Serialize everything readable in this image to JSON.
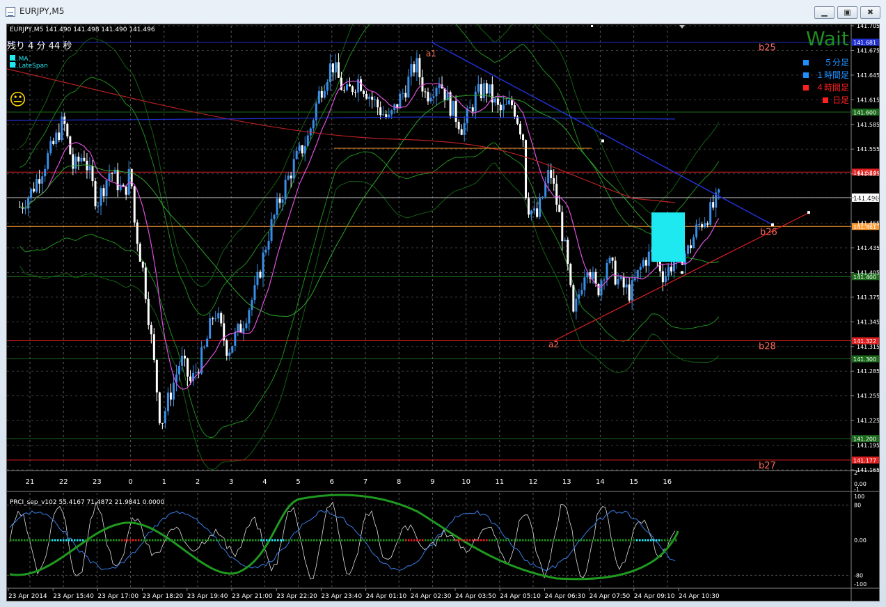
{
  "window": {
    "title": "EURJPY,M5"
  },
  "info": {
    "header": "EURJPY,M5  141.490 141.498 141.490 141.496",
    "countdown": "残り 4 分 44 秒",
    "legend": [
      "1.MA",
      "2.LateSpan"
    ],
    "wait": "Wait",
    "emoji": "😐"
  },
  "timeframes": [
    {
      "label": "５分足",
      "color": "#1e90ff"
    },
    {
      "label": "１時間足",
      "color": "#1e90ff"
    },
    {
      "label": "４時間足",
      "color": "#ff2020"
    },
    {
      "label": "日足",
      "color": "#ff2020"
    }
  ],
  "levels": [
    {
      "name": "b25",
      "price": 141.685,
      "label": "141.681",
      "color": "#2030d0",
      "tagbg": "#2030d0"
    },
    {
      "name": "",
      "price": 141.6,
      "label": "141.600",
      "color": "#1a6a1a",
      "tagbg": "#1a6a1a"
    },
    {
      "name": "",
      "price": 141.527,
      "label": "141.524",
      "color": "#e02020",
      "tagbg": "#e02020"
    },
    {
      "name": "b26",
      "price": 141.461,
      "label": "141.461",
      "color": "#ff9a30",
      "tagbg": "#ff9a30"
    },
    {
      "name": "",
      "price": 141.4,
      "label": "141.400",
      "color": "#1a6a1a",
      "tagbg": "#1a6a1a"
    },
    {
      "name": "b28",
      "price": 141.322,
      "label": "141.322",
      "color": "#e02020",
      "tagbg": "#e02020"
    },
    {
      "name": "",
      "price": 141.3,
      "label": "141.300",
      "color": "#1a6a1a",
      "tagbg": "#1a6a1a"
    },
    {
      "name": "",
      "price": 141.203,
      "label": "141.200",
      "color": "#1a6a1a",
      "tagbg": "#1a6a1a"
    },
    {
      "name": "b27",
      "price": 141.177,
      "label": "141.177",
      "color": "#e02020",
      "tagbg": "#e02020"
    }
  ],
  "current_price": {
    "price": 141.496,
    "label": "141.496"
  },
  "price_axis": [
    "141.705",
    "141.675",
    "141.645",
    "141.615",
    "141.585",
    "141.555",
    "141.525",
    "141.496",
    "141.465",
    "141.435",
    "141.405",
    "141.375",
    "141.345",
    "141.315",
    "141.285",
    "141.255",
    "141.225",
    "141.195",
    "141.165"
  ],
  "hour_labels": [
    "21",
    "22",
    "23",
    "0",
    "1",
    "2",
    "3",
    "4",
    "5",
    "6",
    "7",
    "8",
    "9",
    "10",
    "11",
    "12",
    "13",
    "14",
    "15",
    "16"
  ],
  "strip_axis": [
    "2",
    "0.00",
    "-1"
  ],
  "indicator": {
    "header": "PRCI_sep_v102 55.4167 71.4872 21.9841 0.0000",
    "axis": [
      "100",
      "80",
      "0.00",
      "-80",
      "-100"
    ]
  },
  "time_axis": [
    "23 Apr 2014",
    "23 Apr 15:40",
    "23 Apr 17:00",
    "23 Apr 18:20",
    "23 Apr 19:40",
    "23 Apr 21:00",
    "23 Apr 22:20",
    "23 Apr 23:40",
    "24 Apr 01:10",
    "24 Apr 02:30",
    "24 Apr 03:50",
    "24 Apr 05:10",
    "24 Apr 06:30",
    "24 Apr 07:50",
    "24 Apr 09:10",
    "24 Apr 10:30"
  ],
  "markers": {
    "a1": "a1",
    "a2": "a2"
  },
  "colors": {
    "bull": "#3a8ee8",
    "bear": "#ffffff",
    "ma": "#e050e0",
    "bands": "#1f8f1f",
    "box": "#1ee8f0"
  }
}
